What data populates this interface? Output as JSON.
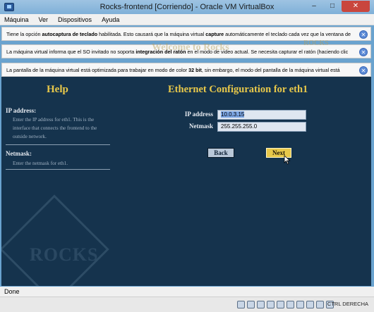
{
  "window": {
    "title": "Rocks-frontend [Corriendo] - Oracle VM VirtualBox",
    "minimize": "–",
    "maximize": "□",
    "close": "✕"
  },
  "menu": [
    "Máquina",
    "Ver",
    "Dispositivos",
    "Ayuda"
  ],
  "notices": [
    {
      "before": "Tiene la opción ",
      "bold1": "autocaptura de teclado",
      "mid": " habilitada. Esto causará que la máquina virtual ",
      "bold2": "capture",
      "after": " automáticamente el teclado cada vez que la ventana de"
    },
    {
      "before": "La máquina virtual informa que el SO invitado no soporta ",
      "bold1": "integración del ratón",
      "mid": " en el modo de video actual. Se necesita capturar el ratón (haciendo clic",
      "bold2": "",
      "after": ""
    },
    {
      "before": "La pantalla de la máquina virtual está optimizada para trabajar en modo de color ",
      "bold1": "32 bit",
      "mid": ", sin embargo, el modo del pantalla de la máquina virtual está",
      "bold2": "",
      "after": ""
    }
  ],
  "watermark": {
    "welcome": "Welcome to Rocks",
    "logo": "ROCKS"
  },
  "guest": {
    "help_title": "Help",
    "ip_label": "IP address:",
    "ip_help": "Enter the IP address for eth1. This is the interface that connects the frontend to the outside network.",
    "netmask_label": "Netmask:",
    "netmask_help": "Enter the netmask for eth1.",
    "logo_text": "ROCKS",
    "main_title": "Ethernet Configuration for eth1",
    "form": {
      "ip_label": "IP address",
      "ip_value": "10.0.3.15",
      "netmask_label": "Netmask",
      "netmask_value": "255.255.255.0"
    },
    "back": "Back",
    "next": "Next"
  },
  "status": {
    "text": "Done"
  },
  "tray": {
    "hostkey": "CTRL DERECHA"
  }
}
